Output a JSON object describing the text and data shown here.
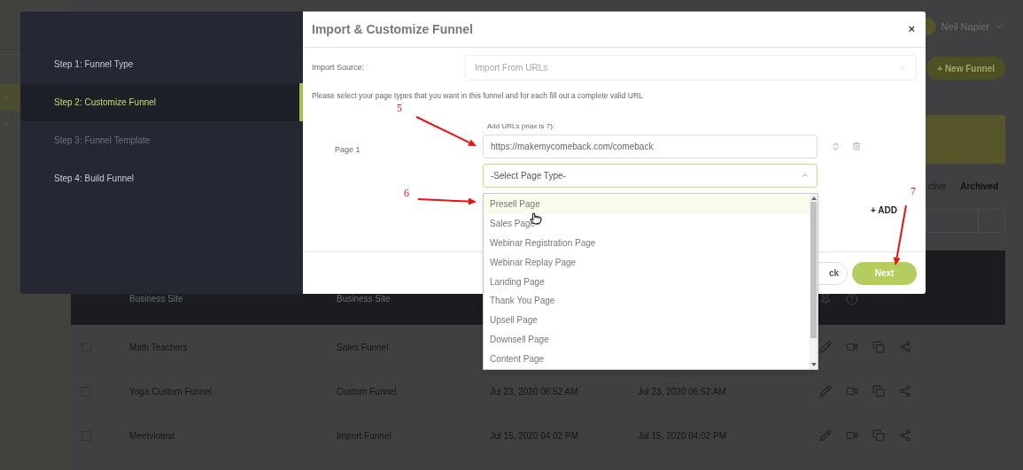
{
  "background": {
    "user": {
      "name": "Neil Napier"
    },
    "new_funnel_button": "+ New Funnel",
    "tabs": [
      {
        "label": "ctive",
        "selected": false
      },
      {
        "label": "Archived",
        "selected": true
      }
    ],
    "table": {
      "rows": [
        {
          "kind": "featured",
          "name": "Business Site",
          "type": "Business Site"
        },
        {
          "kind": "funnel",
          "checked": false,
          "name": "Math Teachers",
          "type": "Sales Funnel"
        },
        {
          "kind": "funnel",
          "checked": false,
          "name": "Yoga Custom Funnel",
          "type": "Custom Funnel",
          "created": "Jul 23, 2020 06:52 AM",
          "modified": "Jul 23, 2020 06:52 AM"
        },
        {
          "kind": "funnel",
          "checked": false,
          "name": "Meetviotest",
          "type": "Import Funnel",
          "created": "Jul 15, 2020 04:02 PM",
          "modified": "Jul 15, 2020 04:02 PM"
        }
      ]
    }
  },
  "modal": {
    "title": "Import & Customize Funnel",
    "close": "×",
    "steps": [
      {
        "label": "Step 1: Funnel Type",
        "selected": false,
        "disabled": false
      },
      {
        "label": "Step 2: Customize Funnel",
        "selected": true,
        "disabled": false
      },
      {
        "label": "Step 3: Funnel Template",
        "selected": false,
        "disabled": true
      },
      {
        "label": "Step 4: Build Funnel",
        "selected": false,
        "disabled": false
      }
    ],
    "import_source": {
      "label": "Import Source:",
      "value": "Import From URLs"
    },
    "instruction": "Please select your page types that you want in this funnel and for each fill out a complete valid URL",
    "urls_label": "Add URLs (max is 7):",
    "page": {
      "label": "Page 1",
      "url": "https://makemycomeback.com/comeback",
      "page_type": {
        "placeholder": "-Select Page Type-",
        "expanded": true
      }
    },
    "add_button": "+ ADD",
    "buttons": [
      {
        "kind": "back",
        "label": "ck"
      },
      {
        "kind": "next",
        "label": "Next"
      }
    ]
  },
  "dropdown": {
    "items": [
      {
        "label": "Presell Page",
        "highlighted": true
      },
      {
        "label": "Sales Page",
        "highlighted": false
      },
      {
        "label": "Webinar Registration Page",
        "highlighted": false
      },
      {
        "label": "Webinar Replay Page",
        "highlighted": false
      },
      {
        "label": "Landing Page",
        "highlighted": false
      },
      {
        "label": "Thank You Page",
        "highlighted": false
      },
      {
        "label": "Upsell Page",
        "highlighted": false
      },
      {
        "label": "Downsell Page",
        "highlighted": false
      },
      {
        "label": "Content Page",
        "highlighted": false
      }
    ]
  },
  "annotations": [
    {
      "label": "5"
    },
    {
      "label": "6"
    },
    {
      "label": "7"
    }
  ]
}
